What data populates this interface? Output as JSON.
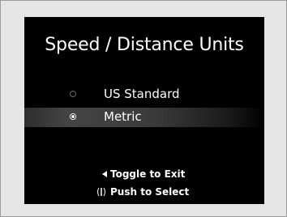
{
  "screen": {
    "title": "Speed / Distance Units",
    "options": [
      {
        "label": "US Standard",
        "selected": false
      },
      {
        "label": "Metric",
        "selected": true
      }
    ],
    "hints": {
      "exit": "Toggle to Exit",
      "exit_icon": "left-triangle-icon",
      "select": "Push to Select",
      "select_icon": "push-knob-icon"
    }
  },
  "colors": {
    "background": "#000000",
    "text": "#ffffff",
    "frame": "#e6e6e6"
  }
}
